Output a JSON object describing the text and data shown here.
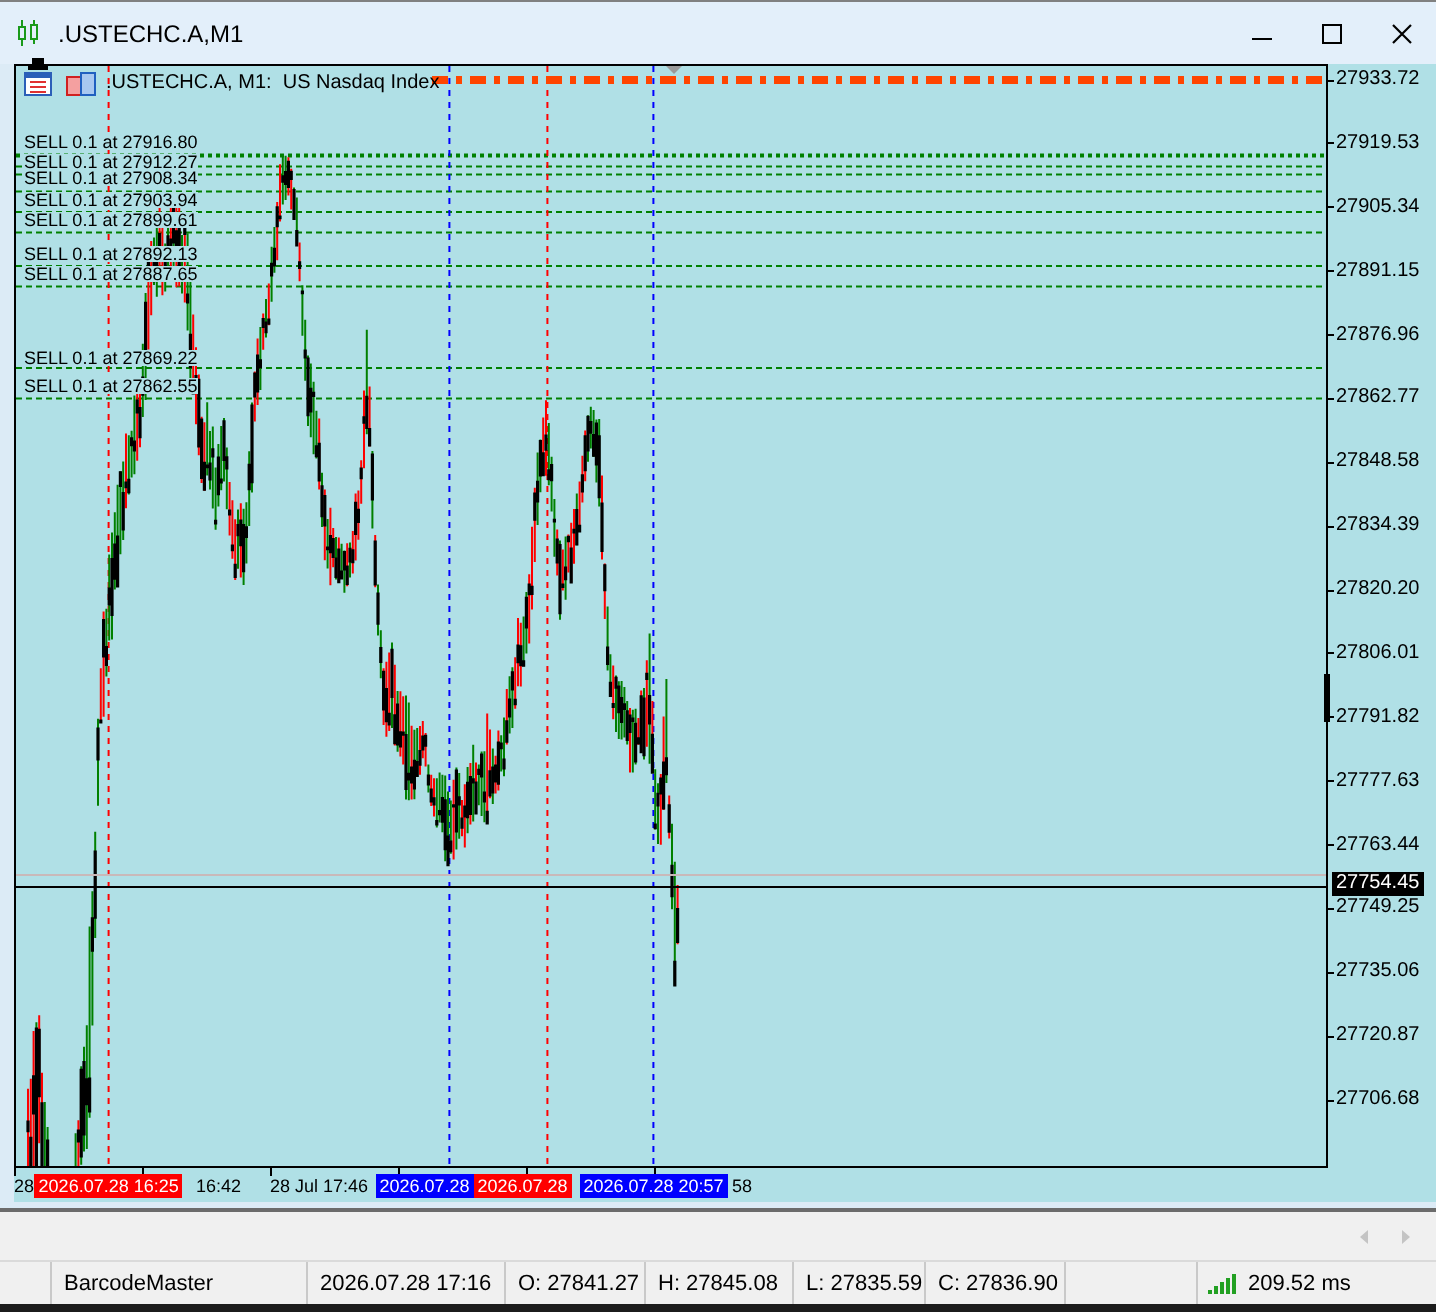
{
  "window": {
    "title": ".USTECHC.A,M1"
  },
  "chart": {
    "header": ".USTECHC.A, M1:  US Nasdaq Index",
    "orders": [
      "SELL 0.1 at 27916.80",
      "SELL 0.1 at 27912.27",
      "SELL 0.1 at 27908.34",
      "SELL 0.1 at 27903.94",
      "SELL 0.1 at 27899.61",
      "SELL 0.1 at 27892.13",
      "SELL 0.1 at 27887.65",
      "SELL 0.1 at 27869.22",
      "SELL 0.1 at 27862.55"
    ],
    "price_axis": [
      "27933.72",
      "27919.53",
      "27905.34",
      "27891.15",
      "27876.96",
      "27862.77",
      "27848.58",
      "27834.39",
      "27820.20",
      "27806.01",
      "27791.82",
      "27777.63",
      "27763.44",
      "27749.25",
      "27735.06",
      "27720.87",
      "27706.68"
    ],
    "current_price": "27754.45",
    "time_axis": [
      "28",
      "16:42",
      "28 Jul 17:46",
      "58"
    ],
    "time_markers": [
      {
        "label": "2026.07.28 16:25",
        "color": "#ff0000"
      },
      {
        "label": "2026.07.28",
        "color": "#0000ff"
      },
      {
        "label": "2026.07.28",
        "color": "#ff0000"
      },
      {
        "label": "2026.07.28 20:57",
        "color": "#0000ff"
      }
    ]
  },
  "status_bar": {
    "cells": [
      "BarcodeMaster",
      "2026.07.28 17:16",
      "O: 27841.27",
      "H: 27845.08",
      "L: 27835.59",
      "C: 27836.90"
    ],
    "ping": "209.52 ms"
  }
}
